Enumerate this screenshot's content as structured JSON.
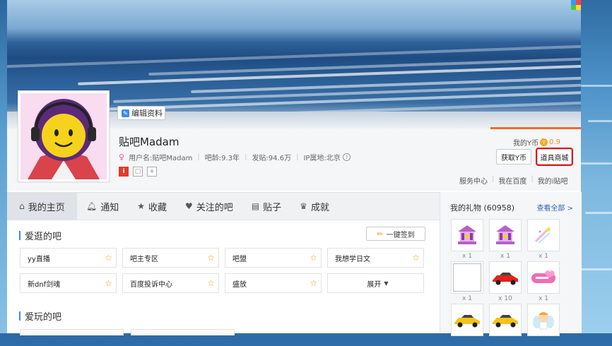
{
  "profile": {
    "edit_label": "编辑资料",
    "username": "贴吧Madam",
    "user_id_text": "用户名:贴吧Madam",
    "age_text": "吧龄:9.3年",
    "posts_text": "发贴:94.6万",
    "ip_text": "IP属地:北京",
    "help_glyph": "?"
  },
  "wallet": {
    "label": "我的Y币",
    "value": "0.9",
    "get_button": "获取Y币",
    "shop_button": "道具商城"
  },
  "links": [
    "服务中心",
    "我在百度",
    "我的i贴吧"
  ],
  "tabs": [
    {
      "label": "我的主页",
      "icon": "home-icon",
      "active": true
    },
    {
      "label": "通知",
      "icon": "bell-icon"
    },
    {
      "label": "收藏",
      "icon": "star-icon"
    },
    {
      "label": "关注的吧",
      "icon": "heart-icon"
    },
    {
      "label": "贴子",
      "icon": "document-icon"
    },
    {
      "label": "成就",
      "icon": "trophy-icon"
    }
  ],
  "sections": {
    "frequent_title": "爱逛的吧",
    "sign_button": "一键签到",
    "play_title": "爱玩的吧"
  },
  "ba_list": [
    "yy直播",
    "吧主专区",
    "吧盟",
    "我想学日文",
    "新dnf剑魂",
    "百度投诉中心",
    "盛放"
  ],
  "expand_label": "展开",
  "gifts": {
    "title": "我的礼物",
    "count": "(60958)",
    "view_all": "查看全部 >",
    "items": [
      {
        "name": "carousel-gift",
        "count": "x 1"
      },
      {
        "name": "carousel-gift",
        "count": "x 1"
      },
      {
        "name": "sparkle-gift",
        "count": "x 1"
      },
      {
        "name": "broken-image-gift",
        "count": "x 1"
      },
      {
        "name": "red-car-gift",
        "count": "x 10"
      },
      {
        "name": "love-gift",
        "count": "x 1"
      },
      {
        "name": "yellow-car-gift",
        "count": ""
      },
      {
        "name": "yellow-car-gift",
        "count": ""
      },
      {
        "name": "angel-gift",
        "count": ""
      }
    ]
  },
  "colors": {
    "accent_blue": "#3a8ee6",
    "orange": "#f06b2d",
    "highlight_red": "#e0111b"
  }
}
